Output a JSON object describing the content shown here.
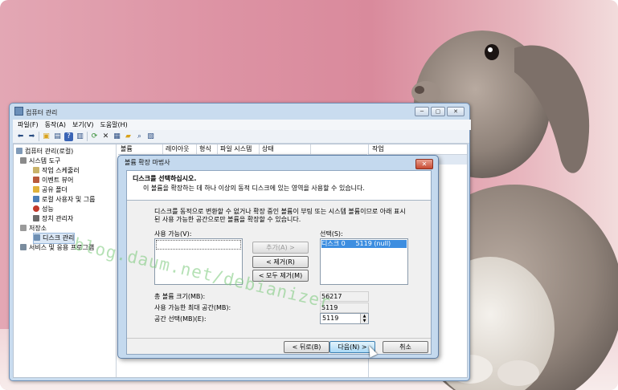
{
  "window": {
    "title": "컴퓨터 관리",
    "controls": {
      "minimize": "─",
      "maximize": "▢",
      "close": "✕"
    }
  },
  "menubar": {
    "items": [
      "파일(F)",
      "동작(A)",
      "보기(V)",
      "도움말(H)"
    ]
  },
  "toolbar": {
    "icons": [
      "back-icon",
      "forward-icon",
      "up-folder-icon",
      "show-hide-tree-icon",
      "help-icon",
      "console-icon",
      "refresh-icon",
      "delete-icon",
      "properties-icon",
      "open-icon",
      "search-icon",
      "export-icon"
    ]
  },
  "tree": {
    "items": [
      {
        "label": "컴퓨터 관리(로컬)",
        "level": 0
      },
      {
        "label": "시스템 도구",
        "level": 1
      },
      {
        "label": "작업 스케줄러",
        "level": 2
      },
      {
        "label": "이벤트 뷰어",
        "level": 2
      },
      {
        "label": "공유 폴더",
        "level": 2
      },
      {
        "label": "로컬 사용자 및 그룹",
        "level": 2
      },
      {
        "label": "성능",
        "level": 2
      },
      {
        "label": "장치 관리자",
        "level": 2
      },
      {
        "label": "저장소",
        "level": 1
      },
      {
        "label": "디스크 관리",
        "level": 2,
        "selected": true
      },
      {
        "label": "서비스 및 응용 프로그램",
        "level": 1
      }
    ]
  },
  "columns": [
    "볼륨",
    "레이아웃",
    "형식",
    "파일 시스템",
    "상태"
  ],
  "actions": {
    "header": "작업"
  },
  "dialog": {
    "title": "볼륨 확장 마법사",
    "close": "✕",
    "heading": "디스크를 선택하십시오.",
    "subheading": "이 볼륨을 확장하는 데 하나 이상의 동적 디스크에 있는 영역을 사용할 수 있습니다.",
    "intro": "디스크를 동적으로 변환할 수 없거나 확장 중인 볼륨이 부팅 또는 시스템 볼륨이므로 아래 표시된 사용 가능한 공간으로만 볼륨을 확장할 수 있습니다.",
    "available_label": "사용 가능(V):",
    "selected_label": "선택(S):",
    "selected_items": [
      {
        "disk": "디스크 0",
        "size": "5119 (null)"
      }
    ],
    "buttons": {
      "add": "추가(A) >",
      "remove": "< 제거(R)",
      "remove_all": "< 모두 제거(M)",
      "back": "< 뒤로(B)",
      "next": "다음(N) >",
      "cancel": "취소"
    },
    "total_size_label": "총 볼륨 크기(MB):",
    "total_size_value": "56217",
    "max_space_label": "사용 가능한 최대 공간(MB):",
    "max_space_value": "5119",
    "select_space_label": "공간 선택(MB)(E):",
    "select_space_value": "5119"
  },
  "watermark": "blog.daum.net/debianizer",
  "colors": {
    "accent": "#3d8ee0",
    "window_frame": "#c9dcef",
    "close_button": "#c74a32",
    "background": "#dd93a4"
  }
}
